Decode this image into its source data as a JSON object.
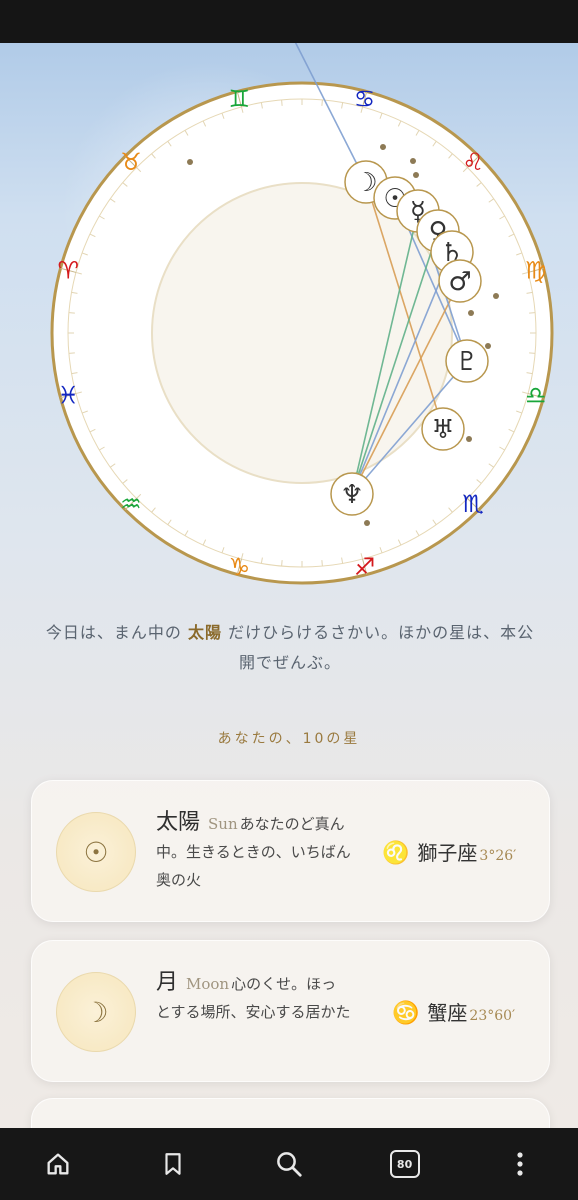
{
  "intro": {
    "prefix": "今日は、まん中の ",
    "highlight": "太陽",
    "suffix": " だけひらけるさかい。ほかの星は、本公開でぜんぶ。"
  },
  "section_title": "あなたの、10の星",
  "cards": [
    {
      "symbol": "☉",
      "name": "太陽",
      "english": "Sun",
      "description": "あなたのど真ん中。生きるときの、いちばん奥の火",
      "sign_glyph": "♌",
      "sign_color": "#d4191c",
      "sign_name": "獅子座",
      "degree": "3°26′"
    },
    {
      "symbol": "☽",
      "name": "月",
      "english": "Moon",
      "description": "心のくせ。ほっとする場所、安心する居かた",
      "sign_glyph": "♋",
      "sign_color": "#1226c0",
      "sign_name": "蟹座",
      "degree": "23°60′"
    }
  ],
  "zodiac": [
    {
      "glyph": "♋",
      "color": "#1226c0"
    },
    {
      "glyph": "♌",
      "color": "#d4191c"
    },
    {
      "glyph": "♍",
      "color": "#e88a16"
    },
    {
      "glyph": "♎",
      "color": "#19a63a"
    },
    {
      "glyph": "♏",
      "color": "#1226c0"
    },
    {
      "glyph": "♐",
      "color": "#d4191c"
    },
    {
      "glyph": "♑",
      "color": "#e88a16"
    },
    {
      "glyph": "♒",
      "color": "#19a63a"
    },
    {
      "glyph": "♓",
      "color": "#1226c0"
    },
    {
      "glyph": "♈",
      "color": "#d4191c"
    },
    {
      "glyph": "♉",
      "color": "#e88a16"
    },
    {
      "glyph": "♊",
      "color": "#19a63a"
    }
  ],
  "planets": [
    {
      "id": "jupiter",
      "glyph": "♃"
    },
    {
      "id": "moon",
      "glyph": "☽"
    },
    {
      "id": "sun",
      "glyph": "☉"
    },
    {
      "id": "mercury",
      "glyph": "☿"
    },
    {
      "id": "venus",
      "glyph": "♀"
    },
    {
      "id": "saturn",
      "glyph": "♄"
    },
    {
      "id": "mars",
      "glyph": "♂"
    },
    {
      "id": "pluto",
      "glyph": "♇"
    },
    {
      "id": "uranus",
      "glyph": "♅"
    },
    {
      "id": "neptune",
      "glyph": "♆"
    }
  ],
  "aspects": [
    {
      "from": "jupiter",
      "to": "moon",
      "color": "#7e9fd0"
    },
    {
      "from": "sun",
      "to": "pluto",
      "color": "#7e9fd0"
    },
    {
      "from": "moon",
      "to": "uranus",
      "color": "#d79d54"
    },
    {
      "from": "mercury",
      "to": "neptune",
      "color": "#5fb088"
    },
    {
      "from": "venus",
      "to": "neptune",
      "color": "#5fb088"
    },
    {
      "from": "saturn",
      "to": "neptune",
      "color": "#7e9fd0"
    },
    {
      "from": "mars",
      "to": "neptune",
      "color": "#d79d54"
    },
    {
      "from": "pluto",
      "to": "neptune",
      "color": "#7e9fd0"
    },
    {
      "from": "mercury",
      "to": "pluto",
      "color": "#7e9fd0"
    }
  ],
  "nav": {
    "home": "home-icon",
    "bookmark": "bookmark-icon",
    "search": "search-icon",
    "tabs_count": "80",
    "menu": "more-vert-icon"
  },
  "colors": {
    "gold": "#b8974e",
    "accent": "#8a6a2b"
  }
}
